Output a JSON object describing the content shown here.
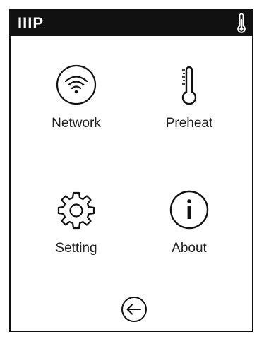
{
  "header": {
    "brand": "IIIP",
    "status_icon": "thermometer-icon"
  },
  "menu": [
    {
      "label": "Network",
      "icon": "wifi-icon"
    },
    {
      "label": "Preheat",
      "icon": "thermometer-icon"
    },
    {
      "label": "Setting",
      "icon": "gear-icon"
    },
    {
      "label": "About",
      "icon": "info-icon"
    }
  ],
  "footer": {
    "back_icon": "back-arrow-icon"
  },
  "colors": {
    "titlebar": "#111111",
    "text": "#222222",
    "background": "#ffffff"
  }
}
